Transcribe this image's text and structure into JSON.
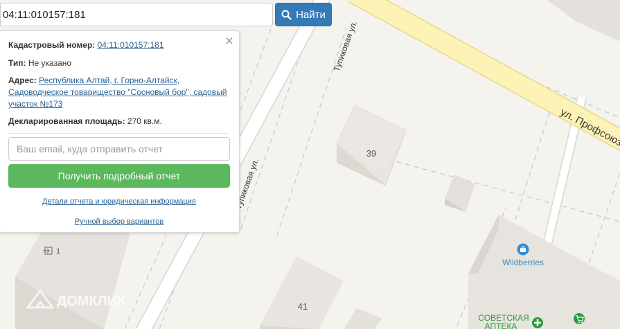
{
  "search": {
    "value": "04:11:010157:181",
    "button_label": "Найти",
    "icon": "search-icon"
  },
  "info_card": {
    "cadastral_label": "Кадастровый номер:",
    "cadastral_value": "04:11:010157:181",
    "type_label": "Тип:",
    "type_value": "Не указано",
    "address_label": "Адрес:",
    "address_value": "Республика Алтай, г. Горно-Алтайск, Садоводческое товарищество \"Сосновый бор\", садовый участок №173",
    "area_label": "Декларированная площадь:",
    "area_value": "270 кв.м.",
    "email_placeholder": "Ваш email, куда отправить отчет",
    "get_report_label": "Получить подробный отчет",
    "details_link": "Детали отчета и юридическая информация",
    "manual_link": "Ручной выбор вариантов",
    "close_icon": "close-icon"
  },
  "map": {
    "street_tupikovaya_upper": "Тупиковая ул.",
    "street_tupikovaya_lower": "Тупиковая ул.",
    "street_profsoyuznaya": "ул. Профсоюзная",
    "building_39": "39",
    "building_41": "41",
    "entrance_label": "1",
    "wildberries": "Wildberries",
    "pharmacy_line1": "СОВЕТСКАЯ",
    "pharmacy_line2": "АПТЕКА",
    "watermark": "ДОМКЛИК",
    "colors": {
      "land": "#f4f3ee",
      "road_main": "#fdf3b6",
      "road_main_edge": "#e8d98e",
      "building": "#e6e2dd",
      "poi_blue": "#2f8fd1",
      "pharmacy_green": "#2a9c3c"
    }
  }
}
